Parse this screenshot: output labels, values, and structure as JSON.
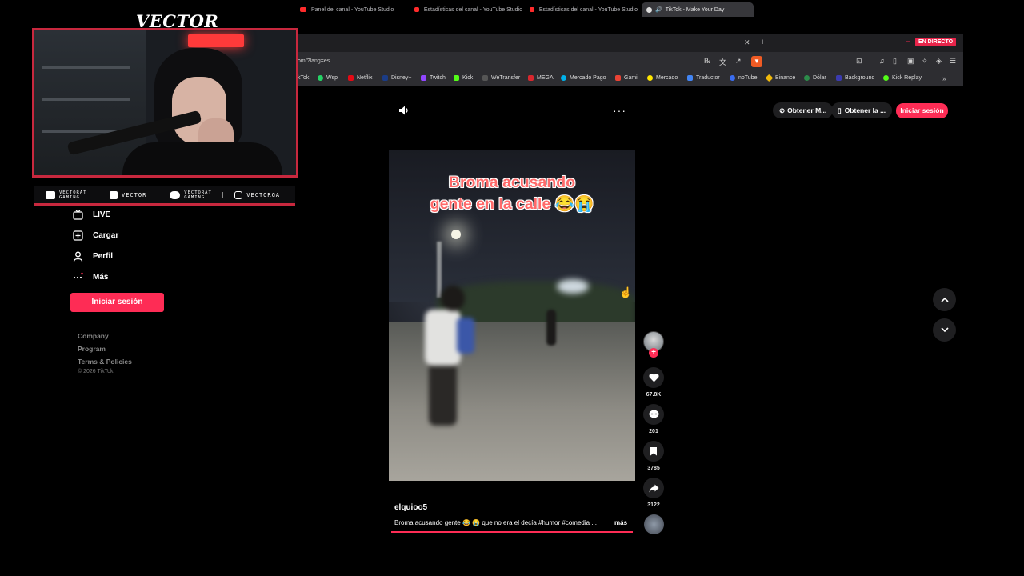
{
  "overlay": {
    "brand": "VECTOR",
    "cam_sign": "",
    "socials": [
      {
        "icon": "youtube-icon",
        "label": "VECTORAT GAMING"
      },
      {
        "icon": "twitch-icon",
        "label": "VECTOR"
      },
      {
        "icon": "twitter-icon",
        "label": "VECTORAT GAMING"
      },
      {
        "icon": "instagram-icon",
        "label": "VECTORGA"
      }
    ],
    "accent": "#c8283e"
  },
  "browser": {
    "tabs": [
      {
        "label": "Panel del canal - YouTube Studio"
      },
      {
        "label": "Estadísticas del canal - YouTube Studio"
      },
      {
        "label": "Estadísticas del canal - YouTube Studio"
      },
      {
        "label": "TikTok - Make Your Day"
      }
    ],
    "live_badge": "EN DIRECTO",
    "url": "om/?lang=es",
    "bookmarks": [
      "kTok",
      "Wsp",
      "Netflix",
      "Disney+",
      "Twitch",
      "Kick",
      "WeTransfer",
      "MEGA",
      "Mercado Pago",
      "Gamil",
      "Mercado",
      "Traductor",
      "noTube",
      "Binance",
      "Dólar",
      "Background",
      "Kick Replay"
    ]
  },
  "sidebar": {
    "items": [
      {
        "label": "LIVE",
        "icon": "live-icon"
      },
      {
        "label": "Cargar",
        "icon": "upload-icon"
      },
      {
        "label": "Perfil",
        "icon": "profile-icon"
      },
      {
        "label": "Más",
        "icon": "more-icon"
      }
    ],
    "login": "Iniciar sesión",
    "footer": [
      "Company",
      "Program",
      "Terms & Policies"
    ],
    "copyright": "© 2026 TikTok"
  },
  "header": {
    "get_app_1": "Obtener M...",
    "get_app_2": "Obtener la ...",
    "login": "Iniciar sesión"
  },
  "video": {
    "caption_line1": "Broma acusando",
    "caption_line2": "gente en la calle 😂😭",
    "author": "elquioo5",
    "description": "Broma acusando gente 😂 😭 que no era el decía #humor #comedia ...",
    "more": "más",
    "likes": "67.8K",
    "comments": "201",
    "saves": "3785",
    "shares": "3122",
    "progress": 1.0
  },
  "colors": {
    "tiktok_red": "#fe2c55",
    "live_red": "#e8244a"
  }
}
